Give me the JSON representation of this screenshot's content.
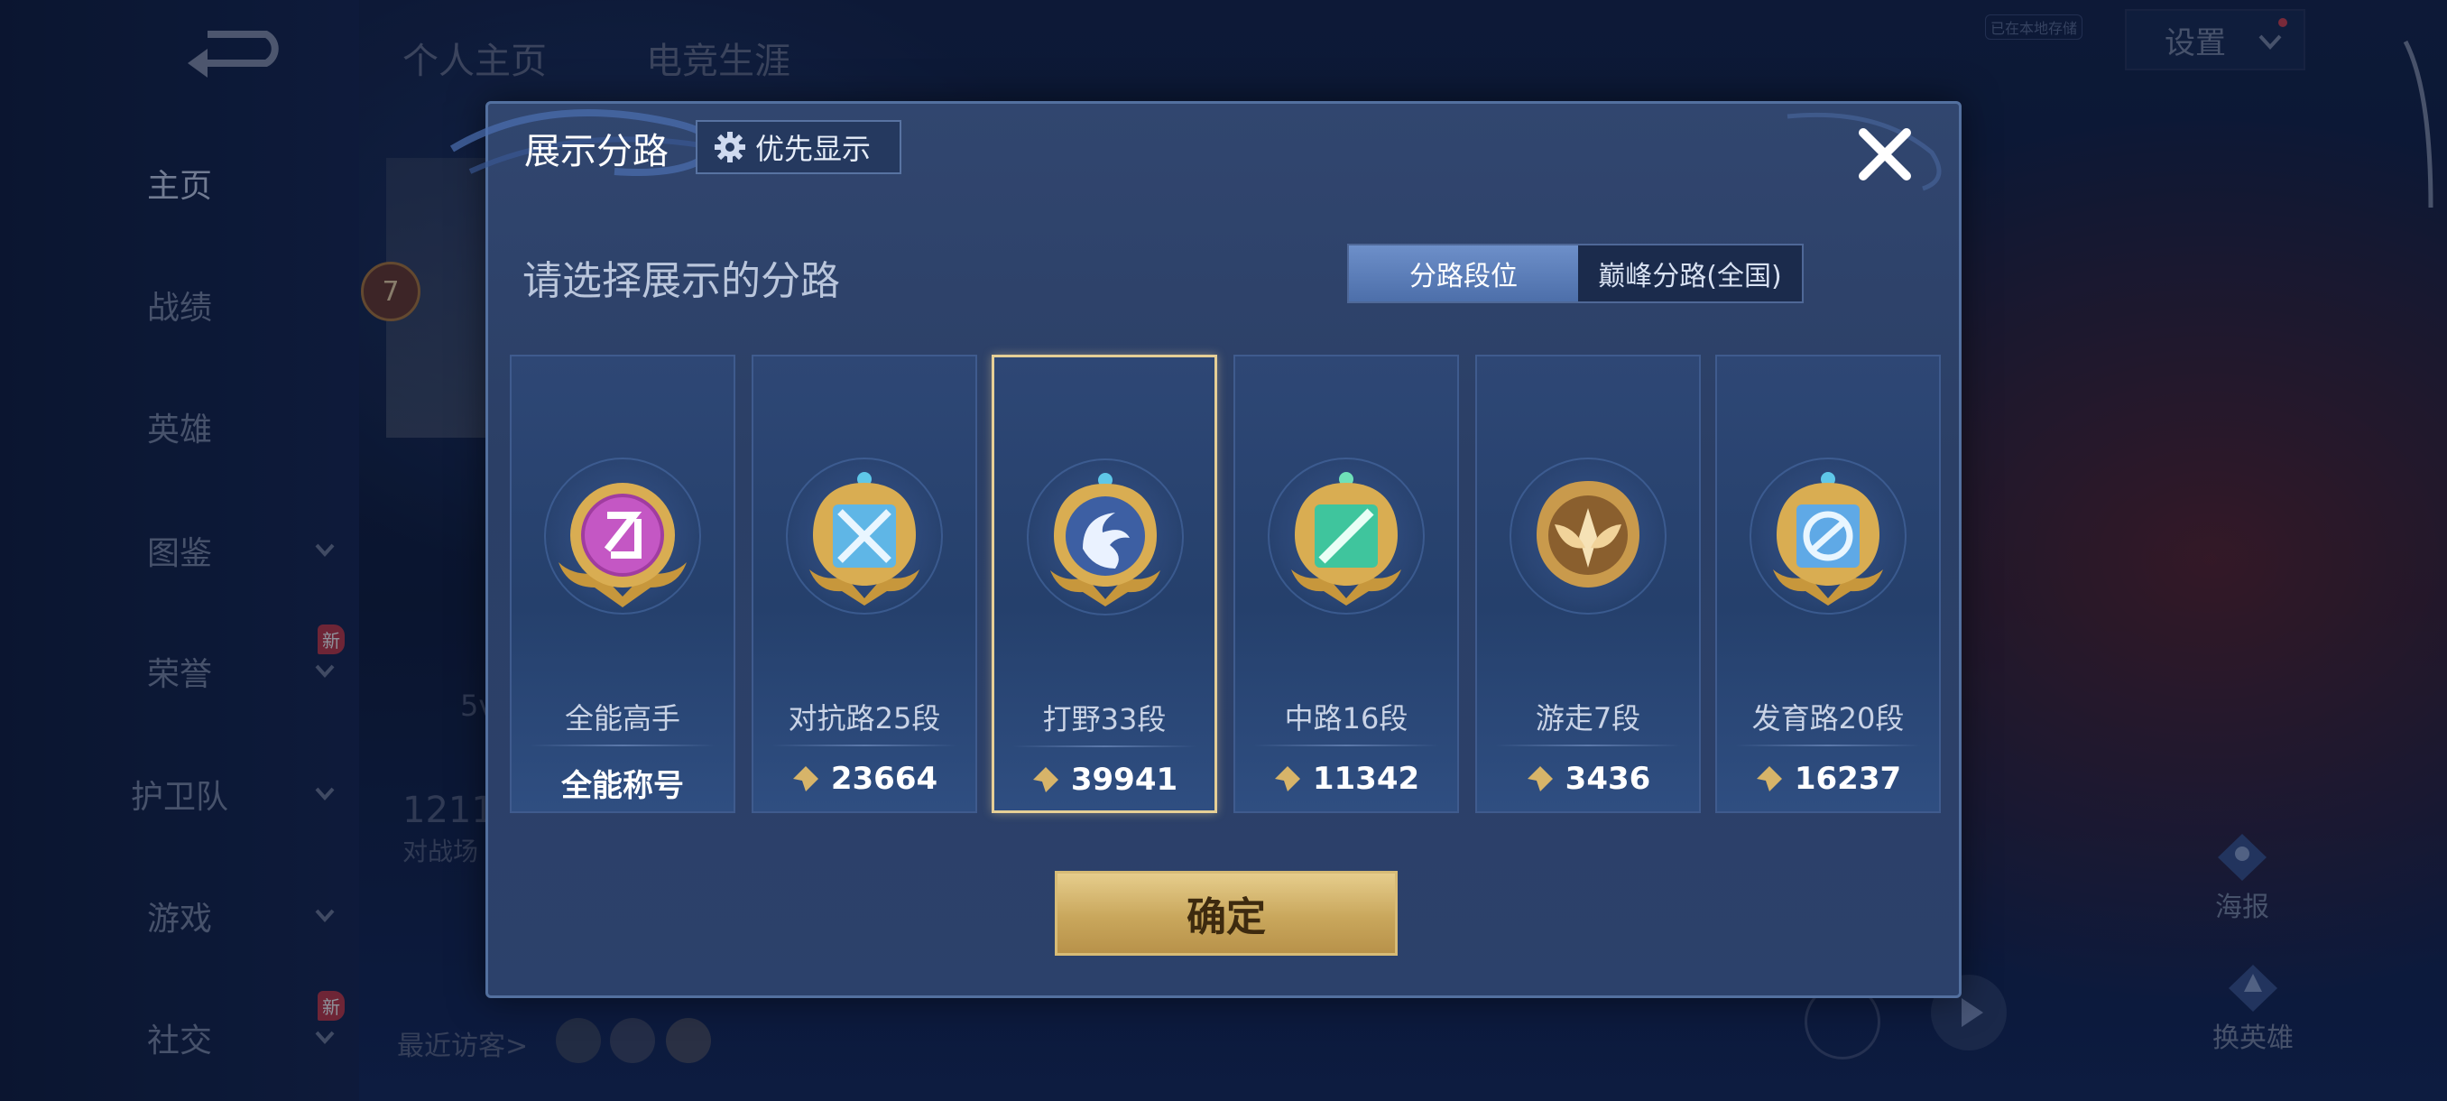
{
  "header": {
    "tabs": [
      "个人主页",
      "电竞生涯"
    ],
    "settings_label": "设置",
    "notice_badge": "已在本地存储"
  },
  "sidebar": {
    "items": [
      {
        "label": "主页",
        "active": true,
        "chevron": false,
        "new": false
      },
      {
        "label": "战绩",
        "active": false,
        "chevron": false,
        "new": false
      },
      {
        "label": "英雄",
        "active": false,
        "chevron": false,
        "new": false
      },
      {
        "label": "图鉴",
        "active": false,
        "chevron": true,
        "new": false
      },
      {
        "label": "荣誉",
        "active": false,
        "chevron": true,
        "new": true
      },
      {
        "label": "护卫队",
        "active": false,
        "chevron": true,
        "new": false
      },
      {
        "label": "游戏",
        "active": false,
        "chevron": true,
        "new": false
      },
      {
        "label": "社交",
        "active": false,
        "chevron": true,
        "new": true
      }
    ],
    "new_badge": "新"
  },
  "background": {
    "level": "7",
    "mode_text": "5v",
    "count_text": "1211",
    "count_sub": "对战场",
    "recent_visitors": "最近访客>"
  },
  "right_actions": {
    "poster": "海报",
    "switch_hero": "换英雄"
  },
  "modal": {
    "title": "展示分路",
    "priority_button": "优先显示",
    "subtitle": "请选择展示的分路",
    "segments": [
      "分路段位",
      "巅峰分路(全国)"
    ],
    "active_segment": 0,
    "confirm": "确定",
    "selected_card": 2,
    "cards": [
      {
        "name": "全能高手",
        "value": "全能称号",
        "icon": "all-round-emblem",
        "show_points_icon": false
      },
      {
        "name": "对抗路25段",
        "value": "23664",
        "icon": "clash-lane-emblem",
        "show_points_icon": true
      },
      {
        "name": "打野33段",
        "value": "39941",
        "icon": "jungle-emblem",
        "show_points_icon": true
      },
      {
        "name": "中路16段",
        "value": "11342",
        "icon": "mid-lane-emblem",
        "show_points_icon": true
      },
      {
        "name": "游走7段",
        "value": "3436",
        "icon": "roam-emblem",
        "show_points_icon": true
      },
      {
        "name": "发育路20段",
        "value": "16237",
        "icon": "farm-lane-emblem",
        "show_points_icon": true
      }
    ]
  },
  "colors": {
    "accent_gold": "#d7bb76",
    "modal_bg": "#2c416b",
    "segment_active": "#5a7cb8"
  }
}
